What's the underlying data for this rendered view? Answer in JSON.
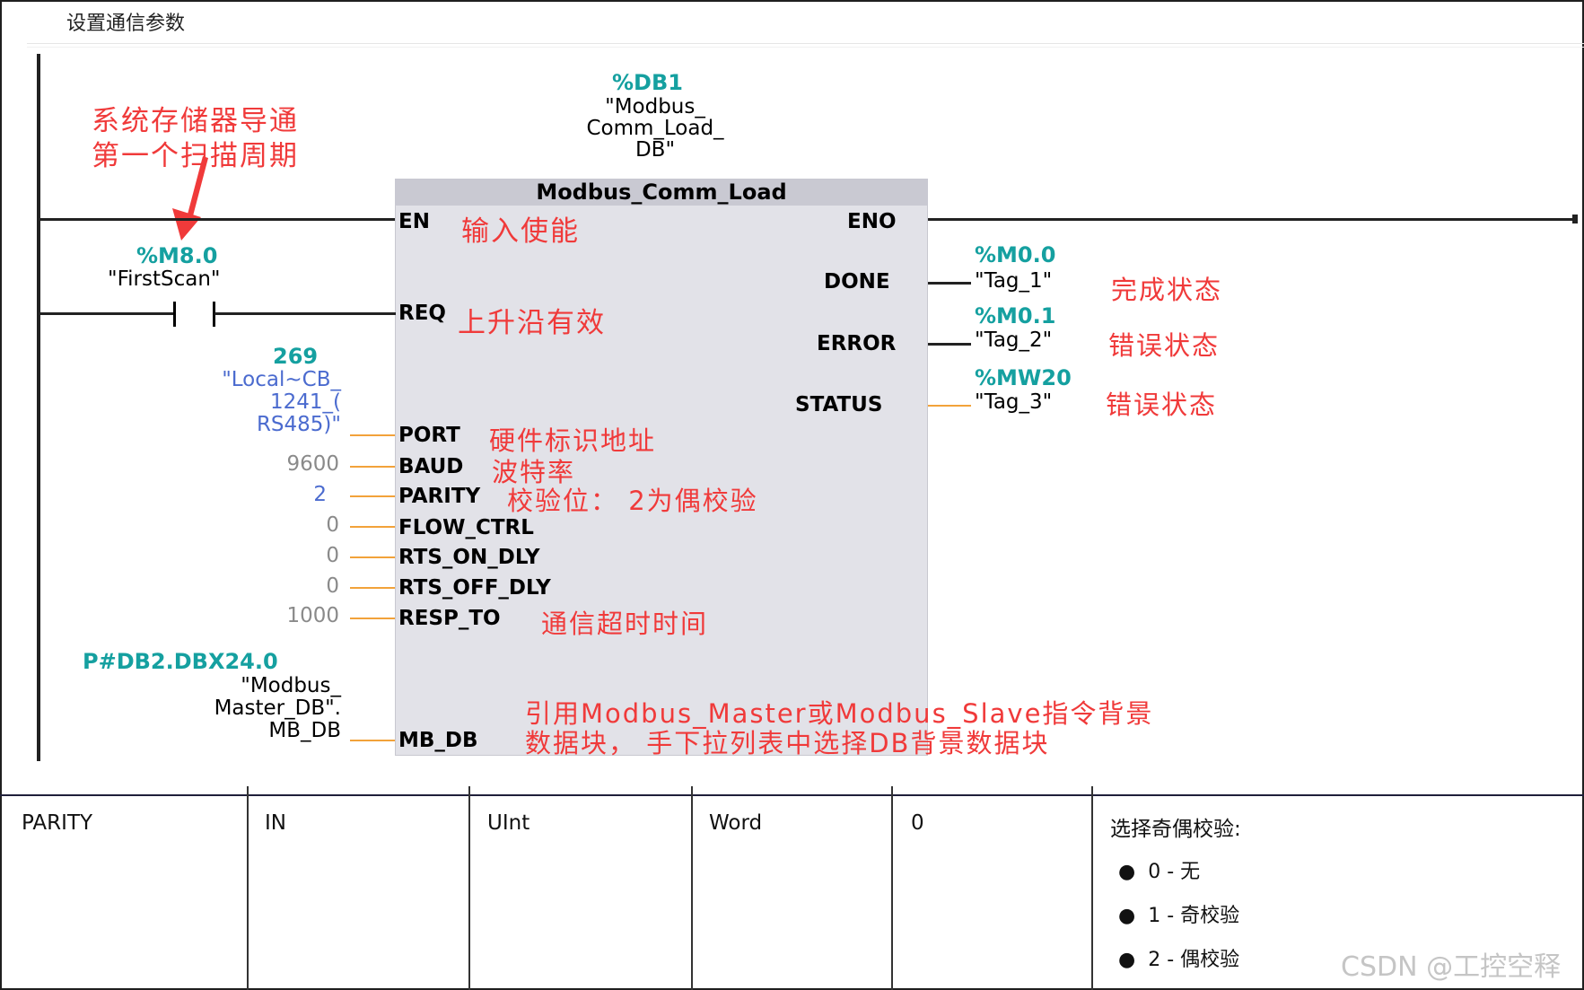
{
  "title": "设置通信参数",
  "instance_db": {
    "address": "%DB1",
    "name_lines": [
      "\"Modbus_",
      "Comm_Load_",
      "DB\""
    ]
  },
  "block": {
    "name": "Modbus_Comm_Load",
    "inputs": {
      "en": "EN",
      "req": "REQ",
      "port": "PORT",
      "baud": "BAUD",
      "parity": "PARITY",
      "flow_ctrl": "FLOW_CTRL",
      "rts_on_dly": "RTS_ON_DLY",
      "rts_off_dly": "RTS_OFF_DLY",
      "resp_to": "RESP_TO",
      "mb_db": "MB_DB"
    },
    "outputs": {
      "eno": "ENO",
      "done": "DONE",
      "error": "ERROR",
      "status": "STATUS"
    }
  },
  "contact": {
    "address": "%M8.0",
    "name": "\"FirstScan\""
  },
  "port_param": {
    "value": "269",
    "name_lines": [
      "\"Local~CB_",
      "1241_(",
      "RS485)\""
    ]
  },
  "baud_value": "9600",
  "parity_value": "2",
  "flow_ctrl_value": "0",
  "rts_on_dly_value": "0",
  "rts_off_dly_value": "0",
  "resp_to_value": "1000",
  "mb_db_param": {
    "address": "P#DB2.DBX24.0",
    "name_lines": [
      "\"Modbus_",
      "Master_DB\".",
      "MB_DB"
    ]
  },
  "outputs_params": {
    "done": {
      "address": "%M0.0",
      "name": "\"Tag_1\""
    },
    "error": {
      "address": "%M0.1",
      "name": "\"Tag_2\""
    },
    "status": {
      "address": "%MW20",
      "name": "\"Tag_3\""
    }
  },
  "annotations": {
    "contact_note_line1": "系统存储器导通",
    "contact_note_line2": "第一个扫描周期",
    "en": "输入使能",
    "req": "上升沿有效",
    "done": "完成状态",
    "error": "错误状态",
    "status": "错误状态",
    "port": "硬件标识地址",
    "baud": "波特率",
    "parity": "校验位： 2为偶校验",
    "resp_to": "通信超时时间",
    "mb_db_line1": "引用Modbus_Master或Modbus_Slave指令背景",
    "mb_db_line2": "数据块， 手下拉列表中选择DB背景数据块"
  },
  "table": {
    "name": "PARITY",
    "section": "IN",
    "data_type": "UInt",
    "memory": "Word",
    "default": "0",
    "description_title": "选择奇偶校验:",
    "description_items": [
      "0 - 无",
      "1 - 奇校验",
      "2 - 偶校验"
    ]
  },
  "watermark": "CSDN @工控空释",
  "colors": {
    "accent_teal": "#15a0a0",
    "annotation_red": "#f03a3a",
    "param_blue": "#4b6bcf",
    "wire_orange": "#f2a23a",
    "block_fill": "#e2e2e8"
  }
}
